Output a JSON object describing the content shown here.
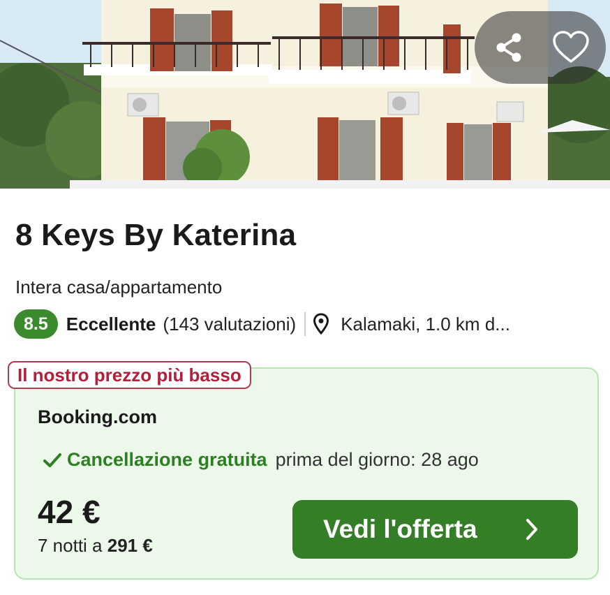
{
  "listing": {
    "title": "8 Keys By Katerina",
    "type": "Intera casa/appartamento",
    "rating": {
      "score": "8.5",
      "label": "Eccellente",
      "count_text": "(143 valutazioni)"
    },
    "location": "Kalamaki, 1.0 km d..."
  },
  "deal": {
    "tag": "Il nostro prezzo più basso",
    "provider": "Booking.com",
    "cancellation": {
      "strong": "Cancellazione gratuita",
      "rest": "prima del giorno: 28 ago"
    },
    "price": "42 €",
    "nights_prefix": "7 notti a ",
    "nights_total": "291 €",
    "cta_label": "Vedi l'offerta"
  },
  "icons": {
    "share": "share-icon",
    "favorite": "heart-icon",
    "location": "map-pin-icon",
    "check": "check-icon",
    "cta": "chevron-right-icon"
  },
  "colors": {
    "score_badge": "#3c8a2e",
    "deal_background": "#ecf9ea",
    "deal_border": "#b7e5b2",
    "tag_text": "#b3203a",
    "cta_background": "#347e27",
    "cancellation_text": "#2f7d24"
  }
}
